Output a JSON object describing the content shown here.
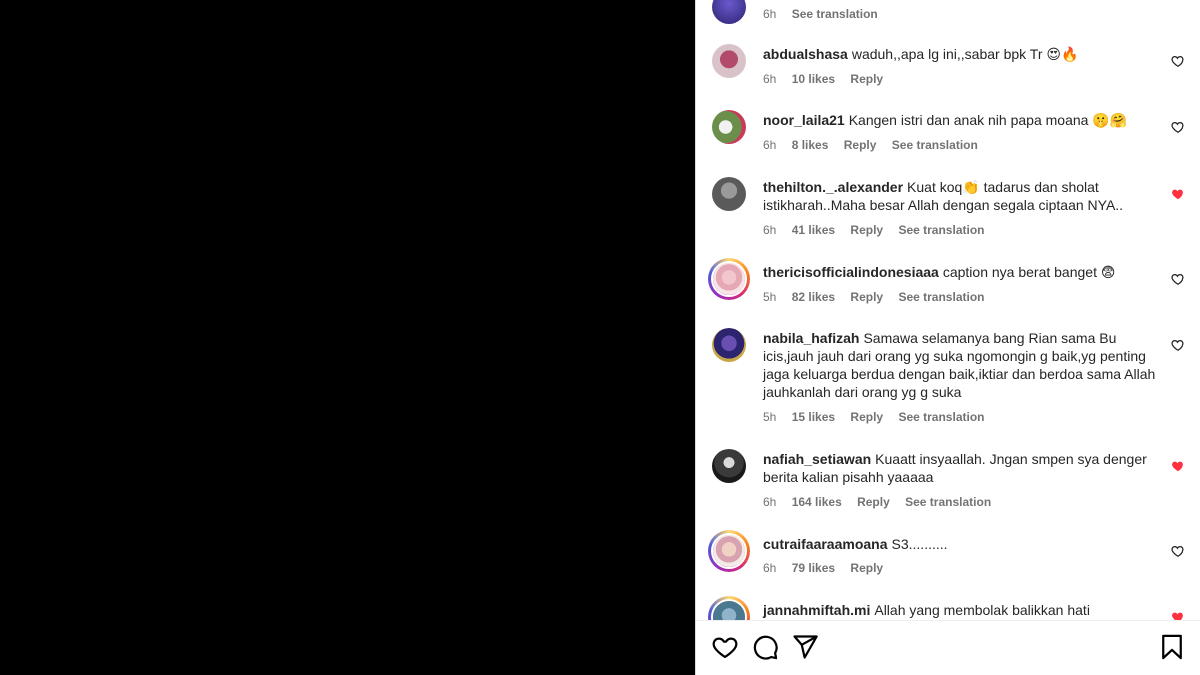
{
  "comments": [
    {
      "username": "",
      "text": "",
      "time": "6h",
      "likes": "",
      "reply": "",
      "translation": "See translation",
      "liked": false
    },
    {
      "username": "abdualshasa",
      "text": "waduh,,apa lg ini,,sabar bpk Tr 😍🔥",
      "time": "6h",
      "likes": "10 likes",
      "reply": "Reply",
      "translation": "",
      "liked": false
    },
    {
      "username": "noor_laila21",
      "text": "Kangen istri dan anak nih papa moana 🤫🤗",
      "time": "6h",
      "likes": "8 likes",
      "reply": "Reply",
      "translation": "See translation",
      "liked": false
    },
    {
      "username": "thehilton._.alexander",
      "text": "Kuat koq👏 tadarus dan sholat istikharah..Maha besar Allah dengan segala ciptaan NYA..",
      "time": "6h",
      "likes": "41 likes",
      "reply": "Reply",
      "translation": "See translation",
      "liked": true
    },
    {
      "username": "thericisofficialindonesiaaa",
      "text": "caption nya berat banget 😨",
      "time": "5h",
      "likes": "82 likes",
      "reply": "Reply",
      "translation": "See translation",
      "liked": false
    },
    {
      "username": "nabila_hafizah",
      "text": "Samawa selamanya bang Rian sama Bu icis,jauh jauh dari orang yg suka ngomongin g baik,yg penting jaga keluarga berdua dengan baik,iktiar dan berdoa sama Allah jauhkanlah dari orang yg g suka",
      "time": "5h",
      "likes": "15 likes",
      "reply": "Reply",
      "translation": "See translation",
      "liked": false
    },
    {
      "username": "nafiah_setiawan",
      "text": "Kuaatt insyaallah. Jngan smpen sya denger berita kalian pisahh yaaaaa",
      "time": "6h",
      "likes": "164 likes",
      "reply": "Reply",
      "translation": "See translation",
      "liked": true
    },
    {
      "username": "cutraifaaraamoana",
      "text": "S3..........",
      "time": "6h",
      "likes": "79 likes",
      "reply": "Reply",
      "translation": "",
      "liked": false
    },
    {
      "username": "jannahmiftah.mi",
      "text": "Allah yang membolak balikkan hati",
      "time": "",
      "likes": "",
      "reply": "",
      "translation": "",
      "liked": true
    }
  ],
  "icons": {
    "like": "heart-icon",
    "comment": "comment-icon",
    "share": "share-icon",
    "save": "bookmark-icon"
  },
  "colors": {
    "liked": "#ff3040",
    "muted": "#737373",
    "text": "#262626"
  }
}
